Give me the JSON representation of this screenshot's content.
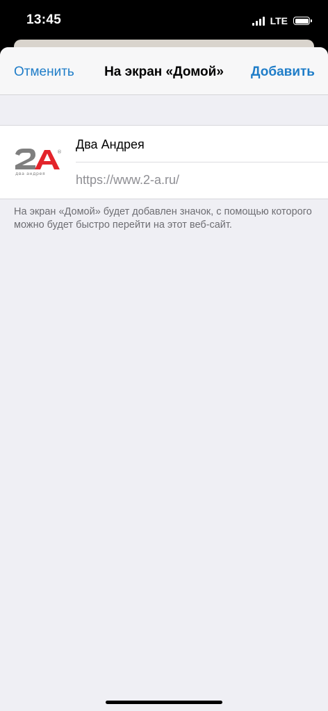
{
  "status_bar": {
    "time": "13:45",
    "network": "LTE",
    "battery_level": 1.0,
    "signal_bars": 4
  },
  "nav": {
    "cancel_label": "Отменить",
    "title": "На экран «Домой»",
    "add_label": "Добавить"
  },
  "form": {
    "name_value": "Два Андрея",
    "url": "https://www.2-a.ru/",
    "icon": {
      "name": "site-logo-2a",
      "logo_text": "2A",
      "logo_subtext": "два андрея",
      "logo_mark": "®"
    }
  },
  "footnote": "На экран «Домой» будет добавлен значок, с помощью которого можно будет быстро перейти на этот веб-сайт.",
  "colors": {
    "accent": "#1f7dc8",
    "logo_red": "#e3242b",
    "logo_gray": "#7f7f7f",
    "background": "#efeff4"
  }
}
